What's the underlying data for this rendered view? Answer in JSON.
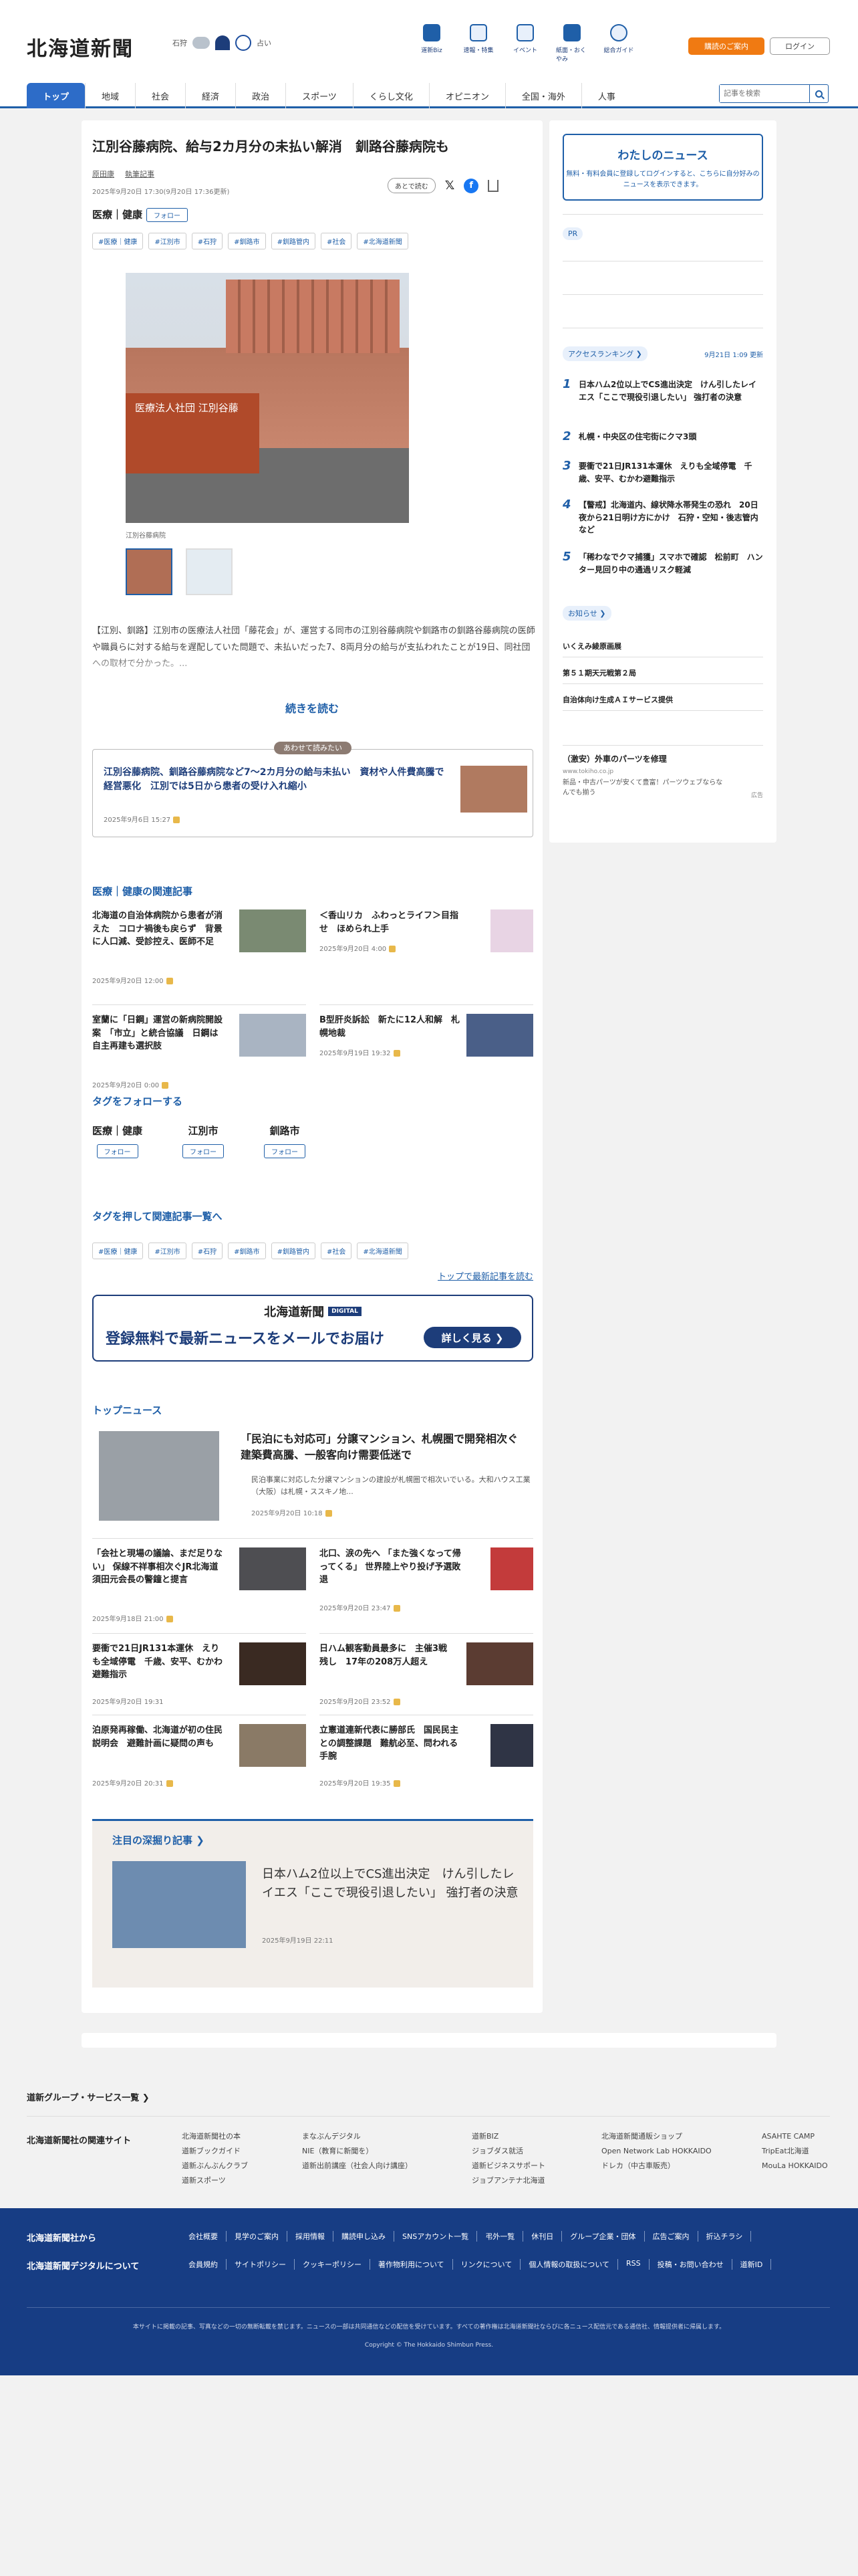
{
  "site": {
    "logo": "北海道新聞"
  },
  "weather": {
    "location": "石狩",
    "fortune_label": "占い"
  },
  "header_nav": [
    {
      "label": "道新Biz"
    },
    {
      "label": "速報・特集"
    },
    {
      "label": "イベント"
    },
    {
      "label": "紙面・おくやみ"
    },
    {
      "label": "総合ガイド"
    }
  ],
  "header_buttons": {
    "subscribe": "購読のご案内",
    "login": "ログイン"
  },
  "nav_tabs": [
    "トップ",
    "地域",
    "社会",
    "経済",
    "政治",
    "スポーツ",
    "くらし文化",
    "オピニオン",
    "全国・海外",
    "人事"
  ],
  "search": {
    "placeholder": "記事を検索"
  },
  "article": {
    "title": "江別谷藤病院、給与2カ月分の未払い解消　釧路谷藤病院も",
    "author": "原田康",
    "author_link": "執筆記事",
    "date": "2025年9月20日 17:30(9月20日 17:36更新)",
    "category": "医療｜健康",
    "follow": "フォロー",
    "later": "あとで読む",
    "tags": [
      "#医療｜健康",
      "#江別市",
      "#石狩",
      "#釧路市",
      "#釧路管内",
      "#社会",
      "#北海道新聞"
    ],
    "caption": "江別谷藤病院",
    "photo_text": "医療法人社団 江別谷藤",
    "lead": "【江別、釧路】江別市の医療法人社団「藤花会」が、運営する同市の江別谷藤病院や釧路市の釧路谷藤病院の医師や職員らに対する給与を遅配していた問題で、未払いだった7、8両月分の給与が支払われたことが19日、同社団への取材で分かった。...",
    "read_more": "続きを読む"
  },
  "also_read": {
    "label": "あわせて読みたい",
    "title": "江別谷藤病院、釧路谷藤病院など7～2カ月分の給与未払い　資材や人件費高騰で経営悪化　江別では5日から患者の受け入れ縮小",
    "date": "2025年9月6日 15:27"
  },
  "related": {
    "heading": "医療｜健康の関連記事",
    "items": [
      {
        "title": "北海道の自治体病院から患者が消えた　コロナ禍後も戻らず　背景に人口減、受診控え、医師不足",
        "date": "2025年9月20日 12:00"
      },
      {
        "title": "＜香山リカ　ふわっとライフ＞目指せ　ほめられ上手",
        "date": "2025年9月20日 4:00"
      },
      {
        "title": "室蘭に「日鋼」運営の新病院開設案　「市立」と統合協議　日鋼は自主再建も選択肢",
        "date": "2025年9月20日 0:00"
      },
      {
        "title": "B型肝炎訴訟　新たに12人和解　札幌地裁",
        "date": "2025年9月19日 19:32"
      }
    ]
  },
  "follow_tags": {
    "heading": "タグをフォローする",
    "items": [
      {
        "name": "医療｜健康"
      },
      {
        "name": "江別市"
      },
      {
        "name": "釧路市"
      }
    ],
    "follow": "フォロー"
  },
  "tag_list": {
    "heading": "タグを押して関連記事一覧へ",
    "tags": [
      "#医療｜健康",
      "#江別市",
      "#石狩",
      "#釧路市",
      "#釧路管内",
      "#社会",
      "#北海道新聞"
    ],
    "top_link": "トップで最新記事を読む"
  },
  "banner": {
    "logo": "北海道新聞",
    "digital": "DIGITAL",
    "text": "登録無料で最新ニュースをメールでお届け",
    "button": "詳しく見る ❯"
  },
  "top_news": {
    "heading": "トップニュース",
    "lead": {
      "title": "「民泊にも対応可」分譲マンション、札幌圏で開発相次ぐ　建築費高騰、一般客向け需要低迷で",
      "summary": "民泊事業に対応した分譲マンションの建設が札幌圏で相次いでいる。大和ハウス工業（大阪）は札幌・ススキノ地...",
      "date": "2025年9月20日 10:18"
    },
    "items": [
      {
        "title": "「会社と現場の議論、まだ足りない」 保線不祥事相次ぐJR北海道　須田元会長の警鐘と提言",
        "date": "2025年9月18日 21:00"
      },
      {
        "title": "北口、涙の先へ 「また強くなって帰ってくる」 世界陸上やり投げ予選敗退",
        "date": "2025年9月20日 23:47"
      },
      {
        "title": "要衝で21日JR131本運休　えりも全域停電　千歳、安平、むかわ避難指示",
        "date": "2025年9月20日 19:31"
      },
      {
        "title": "日ハム観客動員最多に　主催3戦残し　17年の208万人超え",
        "date": "2025年9月20日 23:52"
      },
      {
        "title": "泊原発再稼働、北海道が初の住民説明会　避難計画に疑問の声も",
        "date": "2025年9月20日 20:31"
      },
      {
        "title": "立憲道連新代表に勝部氏　国民民主との調整課題　難航必至、問われる手腕",
        "date": "2025年9月20日 19:35"
      }
    ]
  },
  "deep_dive": {
    "heading": "注目の深掘り記事 ❯",
    "title": "日本ハム2位以上でCS進出決定　けん引したレイエス「ここで現役引退したい」 強打者の決意",
    "date": "2025年9月19日 22:11"
  },
  "sidebar": {
    "mynews": {
      "title": "わたしのニュース",
      "text": "無料・有料会員に登録してログインすると、こちらに自分好みのニュースを表示できます。"
    },
    "pr_label": "PR",
    "ranking": {
      "heading": "アクセスランキング ❯",
      "updated": "9月21日 1:09 更新",
      "items": [
        {
          "rank": "1",
          "title": "日本ハム2位以上でCS進出決定　けん引したレイエス「ここで現役引退したい」 強打者の決意"
        },
        {
          "rank": "2",
          "title": "札幌・中央区の住宅街にクマ3頭"
        },
        {
          "rank": "3",
          "title": "要衝で21日JR131本運休　えりも全域停電　千歳、安平、むかわ避難指示"
        },
        {
          "rank": "4",
          "title": "【警戒】北海道内、線状降水帯発生の恐れ　20日夜から21日明け方にかけ　石狩・空知・後志管内など"
        },
        {
          "rank": "5",
          "title": "「稀わなでクマ捕獲」スマホで確認　松前町　ハンター見回り中の通過リスク軽減"
        }
      ]
    },
    "notices": {
      "heading": "お知らせ ❯",
      "items": [
        "いくえみ綾原画展",
        "第５１期天元戦第２局",
        "自治体向け生成ＡＩサービス提供"
      ]
    },
    "ad": {
      "title": "（激安）外車のパーツを修理",
      "url": "www.tokiho.co.jp",
      "text": "新品・中古パーツが安くて豊富！パーツウェブならなんでも揃う",
      "label": "広告"
    }
  },
  "footer": {
    "group_services": "道新グループ・サービス一覧 ❯",
    "related_sites": "北海道新聞社の関連サイト",
    "cols": [
      [
        "北海道新聞社の本",
        "道新ブックガイド",
        "道新ぶんぶんクラブ",
        "道新スポーツ"
      ],
      [
        "まなぶんデジタル",
        "NIE（教育に新聞を）",
        "道新出前講座（社会人向け講座）"
      ],
      [
        "道新BIZ",
        "ジョブダス就活",
        "道新ビジネスサポート",
        "ジョブアンテナ北海道"
      ],
      [
        "北海道新聞通販ショップ",
        "Open Network Lab HOKKAIDO",
        "ドレカ（中古車販売）"
      ],
      [
        "ASAHTE CAMP",
        "TripEat北海道",
        "MouLa HOKKAIDO"
      ]
    ],
    "company_label": "北海道新聞社から",
    "digital_label": "北海道新聞デジタルについて",
    "company_links": [
      "会社概要",
      "見学のご案内",
      "採用情報",
      "購読申し込み",
      "SNSアカウント一覧",
      "弔外一覧",
      "休刊日",
      "グループ企業・団体",
      "広告ご案内",
      "折込チラシ"
    ],
    "digital_links": [
      "会員規約",
      "サイトポリシー",
      "クッキーポリシー",
      "著作物利用について",
      "リンクについて",
      "個人情報の取扱について",
      "RSS",
      "投稿・お問い合わせ",
      "道新ID"
    ],
    "disclaimer": "本サイトに掲載の記事、写真などの一切の無断転載を禁じます。ニュースの一部は共同通信などの配信を受けています。すべての著作権は北海道新聞社ならびに各ニュース配信元である通信社、情報提供者に帰属します。",
    "copyright": "Copyright © The Hokkaido Shimbun Press."
  }
}
